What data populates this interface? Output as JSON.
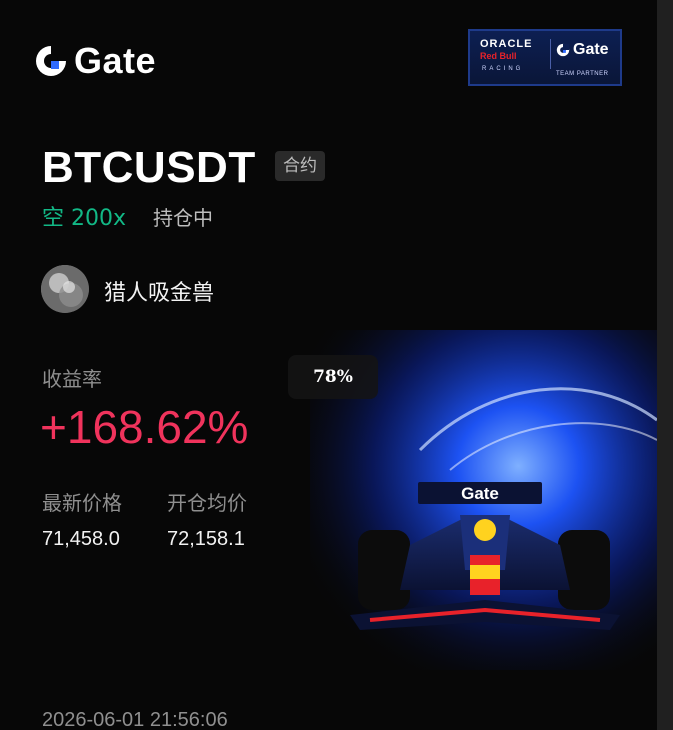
{
  "header": {
    "brand": "Gate",
    "partner": {
      "line1": "ORACLE",
      "line2": "Red Bull",
      "line3": "RACING",
      "brand": "Gate",
      "tagline": "TEAM PARTNER"
    }
  },
  "position": {
    "pair": "BTCUSDT",
    "type_tag": "合约",
    "side": "空 200x",
    "status": "持仓中"
  },
  "user": {
    "name": "猎人吸金兽"
  },
  "stats": {
    "yield_label": "收益率",
    "yield_value": "+168.62%",
    "latest_price_label": "最新价格",
    "latest_price": "71,458.0",
    "entry_price_label": "开仓均价",
    "entry_price": "72,158.1"
  },
  "overlay": {
    "zoom": "78%"
  },
  "footer": {
    "timestamp": "2026-06-01 21:56:06"
  },
  "car": {
    "wing_brand": "Gate"
  },
  "colors": {
    "background": "#070707",
    "short_green": "#12b886",
    "profit_red": "#f0335c",
    "partner_navy": "#0d1f52",
    "glow_blue": "#1e56ff"
  }
}
